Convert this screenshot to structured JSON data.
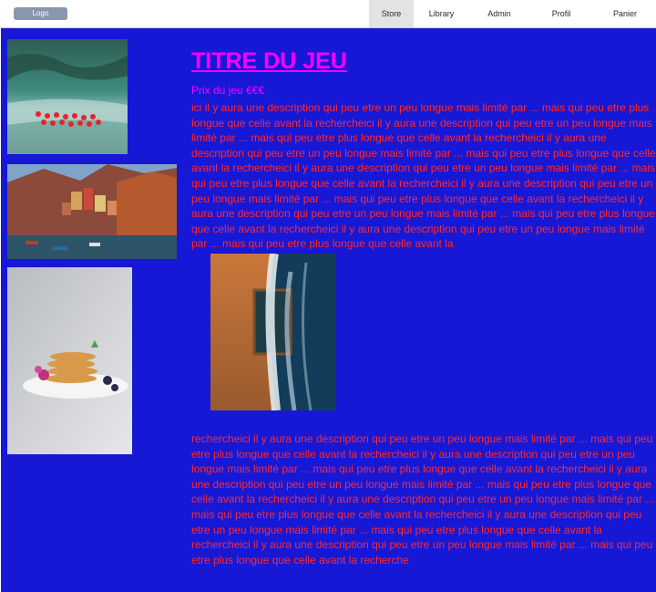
{
  "header": {
    "logo_label": "Logo",
    "nav": [
      "Store",
      "Library",
      "Admin",
      "Profil",
      "Panier"
    ],
    "active_nav": "Store"
  },
  "sidebar": {
    "thumbnails": [
      "beach-parasols-image",
      "coastal-village-image",
      "pancakes-dessert-image"
    ]
  },
  "game": {
    "title": "TITRE DU JEU",
    "price": "Prix du jeu €€€",
    "description_top": " ici il y aura une description  qui peu etre un peu longue mais limité par ... mais qui peu etre plus longue que celle avant la rechercheici il y aura une description  qui peu etre un peu longue mais limité par ... mais qui peu etre plus longue que celle avant la rechercheici il y aura une description  qui peu etre un peu longue mais limité par ... mais qui peu etre plus longue que celle avant la rechercheici il y aura une description  qui peu etre un peu longue mais limité par ... mais qui peu etre plus longue que celle avant la rechercheici il y aura une description  qui peu etre un peu longue mais limité par ... mais qui peu etre plus longue que celle avant la rechercheici il y aura une description  qui peu etre un peu longue mais limité par ... mais qui peu etre plus longue que celle avant la rechercheici il y aura une description  qui peu etre un peu longue mais limité par ... mais qui peu etre plus longue que celle avant la",
    "description_bottom": "rechercheici il y aura une description  qui peu etre un peu longue mais limité par ... mais qui peu etre plus longue que celle avant la rechercheici il y aura une description  qui peu etre un peu longue mais limité par ... mais qui peu etre plus longue que celle avant la rechercheici il y aura une description  qui peu etre un peu longue mais limité par ... mais qui peu etre plus longue que celle avant la rechercheici il y aura une description  qui peu etre un peu longue mais limité par ... mais qui peu etre plus longue que celle avant la rechercheici il y aura une description  qui peu etre un peu longue mais limité par ... mais qui peu etre plus longue que celle avant la rechercheici il y aura une description  qui peu etre un peu longue mais limité par ... mais qui peu etre plus longue que celle avant la recherche",
    "detail_image": "ocean-pool-aerial-image"
  },
  "colors": {
    "page_background": "#1717d6",
    "title": "#ff00ff",
    "price": "#ff00ff",
    "description": "#ff2a2a",
    "logo_background": "#8a96ad",
    "active_nav_background": "#e3e3e3"
  }
}
